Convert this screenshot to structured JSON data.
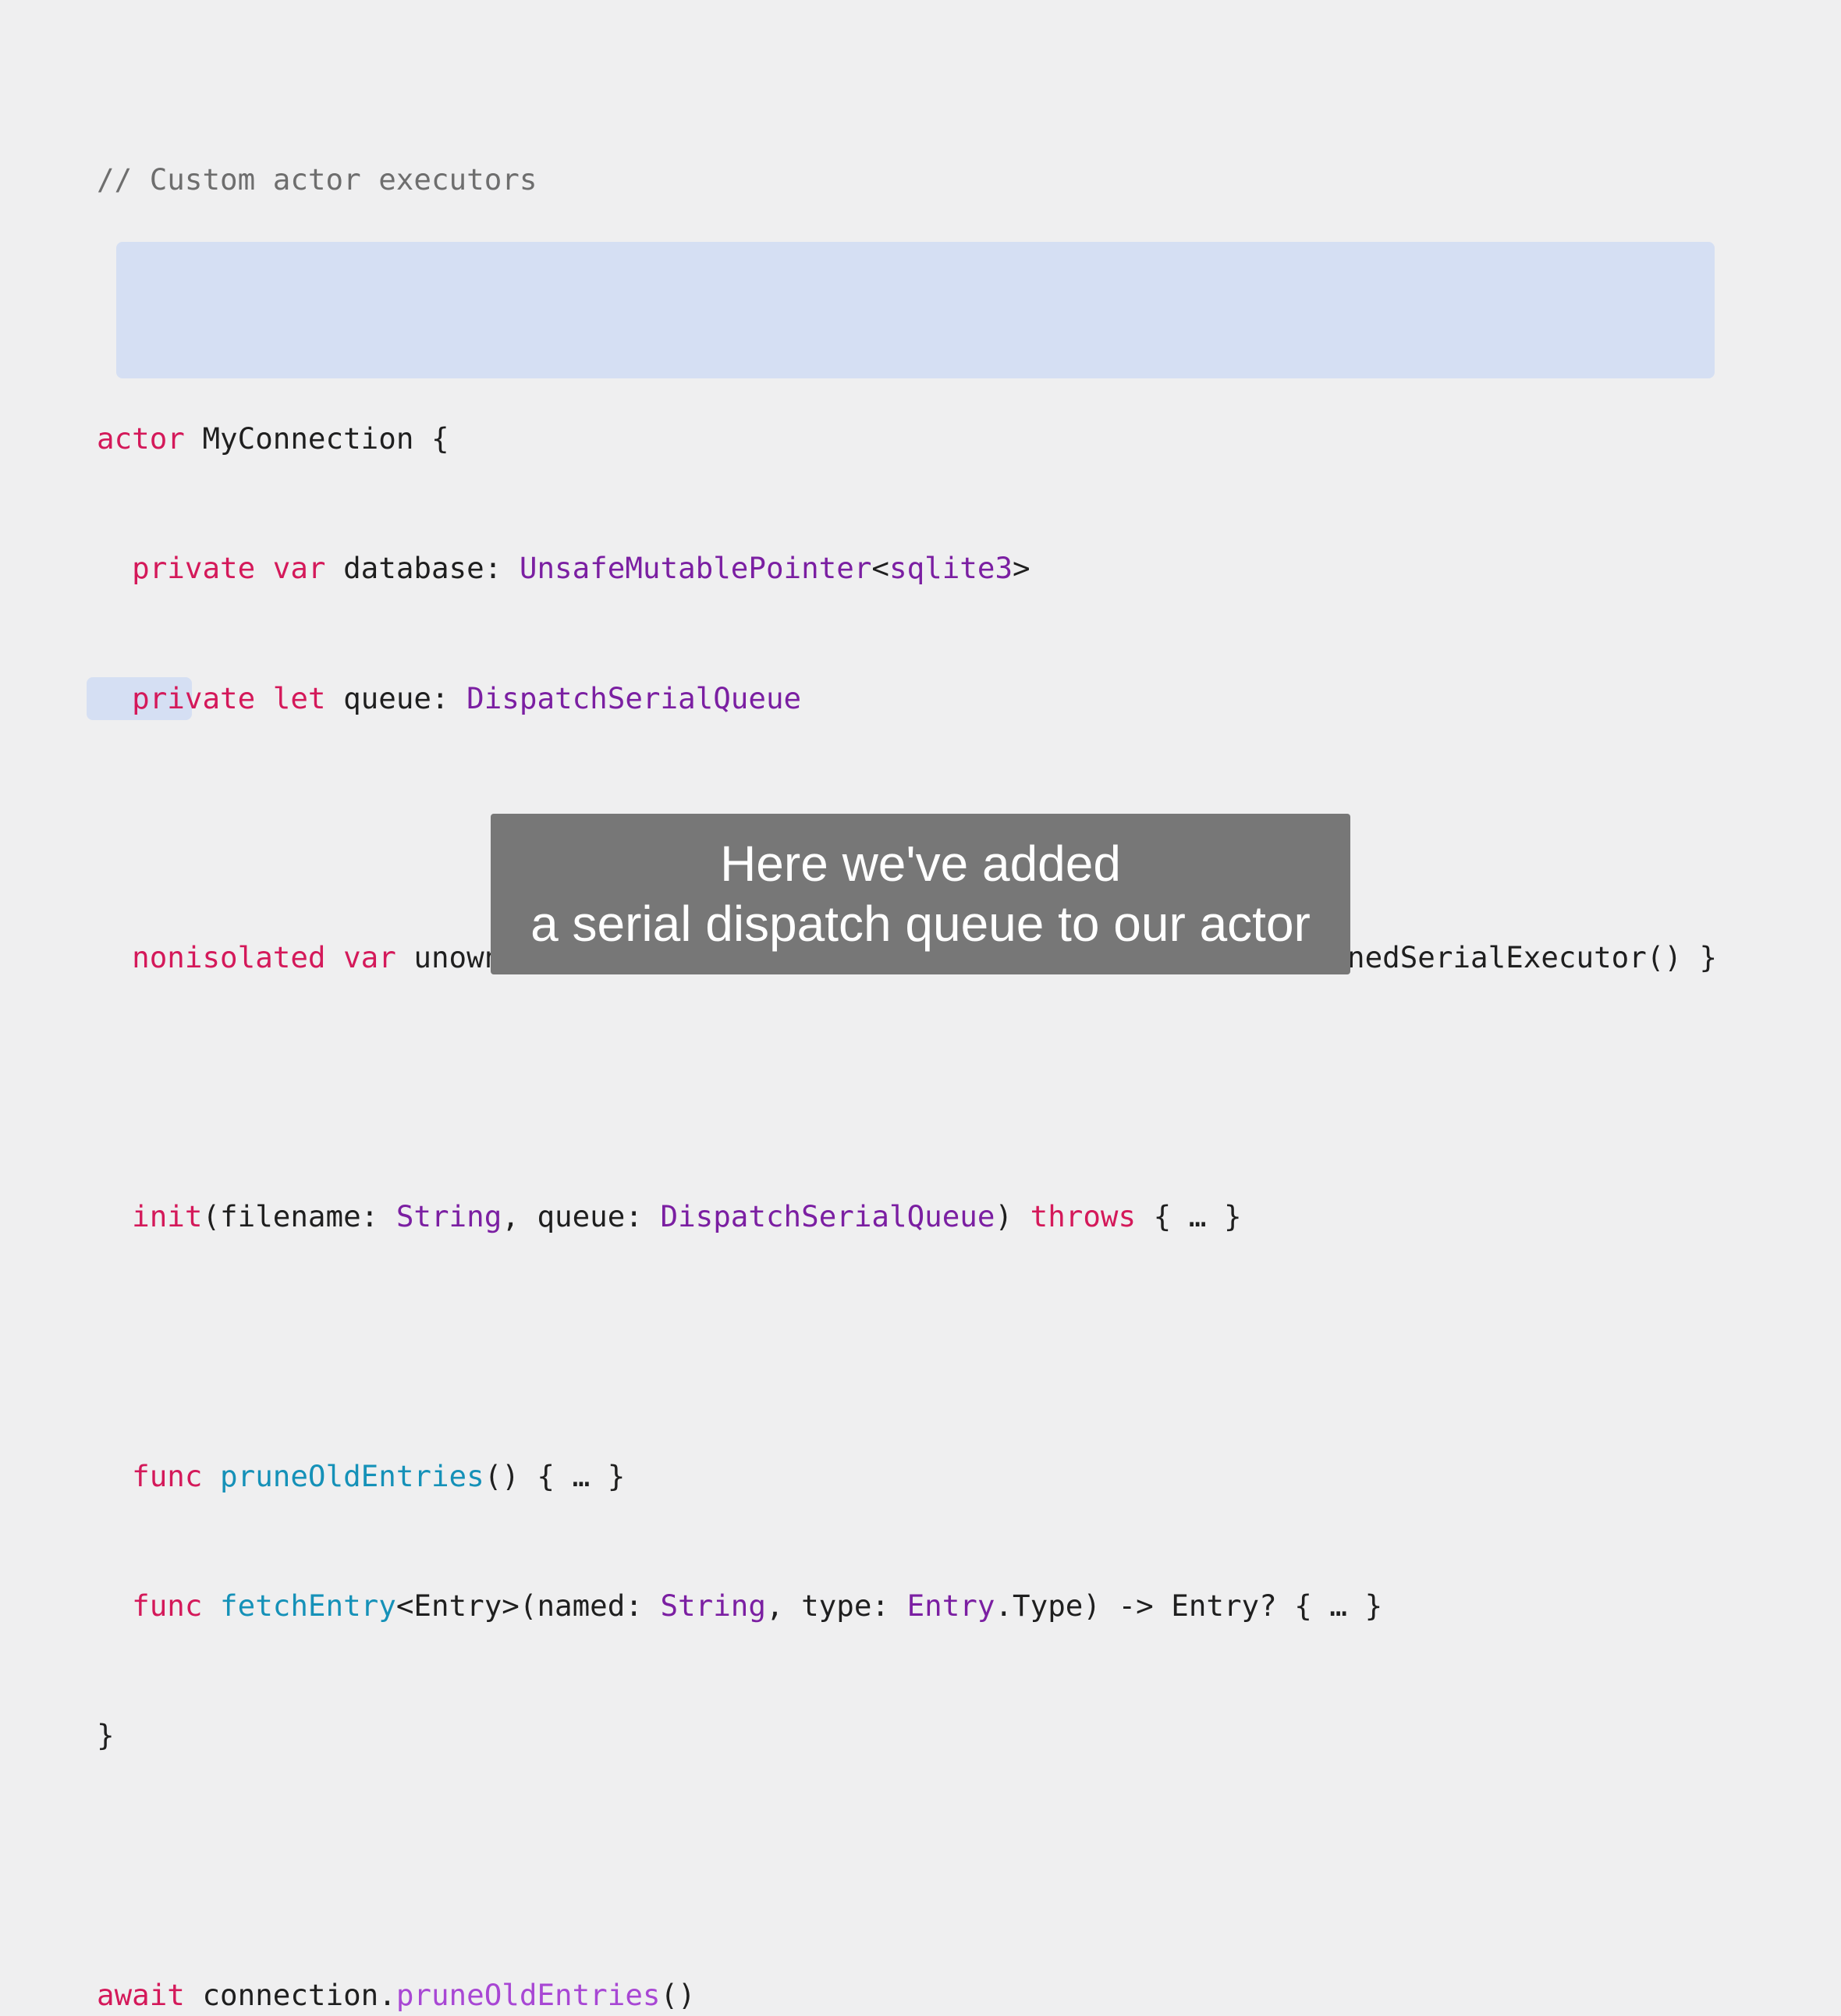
{
  "colors": {
    "background": "#efeff0",
    "keyword": "#d4195a",
    "type": "#7b1fa2",
    "function_decl": "#1591b8",
    "function_call": "#a847d4",
    "comment": "#6e6e6e",
    "highlight": "#d5dff3",
    "caption_bg": "#777777"
  },
  "code": {
    "comment": "// Custom actor executors",
    "l1": {
      "kw": "actor",
      "rest": " MyConnection {"
    },
    "l2": {
      "indent": "  ",
      "kw1": "private",
      "kw2": "var",
      "name": " database: ",
      "type": "UnsafeMutablePointer",
      "lt": "<",
      "generic": "sqlite3",
      "gt": ">"
    },
    "l3": {
      "indent": "  ",
      "kw1": "private",
      "kw2": "let",
      "name": " queue: ",
      "type": "DispatchSerialQueue"
    },
    "l4": {
      "indent": "  ",
      "kw1": "nonisolated",
      "kw2": "var",
      "name": " unownedExecutor: ",
      "type": "UnownedSerialExecutor",
      "rest": " { queue.asUnownedSerialExecutor() }"
    },
    "l5": {
      "indent": "  ",
      "kw": "init",
      "p1": "(filename: ",
      "t1": "String",
      "p2": ", queue: ",
      "t2": "DispatchSerialQueue",
      "p3": ") ",
      "kw2": "throws",
      "rest": " { … }"
    },
    "l6": {
      "indent": "  ",
      "kw": "func",
      "fn": "pruneOldEntries",
      "rest": "() { … }"
    },
    "l7": {
      "indent": "  ",
      "kw": "func",
      "fn": "fetchEntry",
      "p1": "<Entry>(named: ",
      "t1": "String",
      "p2": ", type: ",
      "t2": "Entry",
      "rest": ".Type) -> Entry? { … }"
    },
    "l8": "}",
    "l9": {
      "kw": "await",
      "obj": " connection.",
      "call": "pruneOldEntries",
      "rest": "()"
    }
  },
  "caption": {
    "line1": "Here we've added",
    "line2": "a serial dispatch queue to our actor"
  }
}
